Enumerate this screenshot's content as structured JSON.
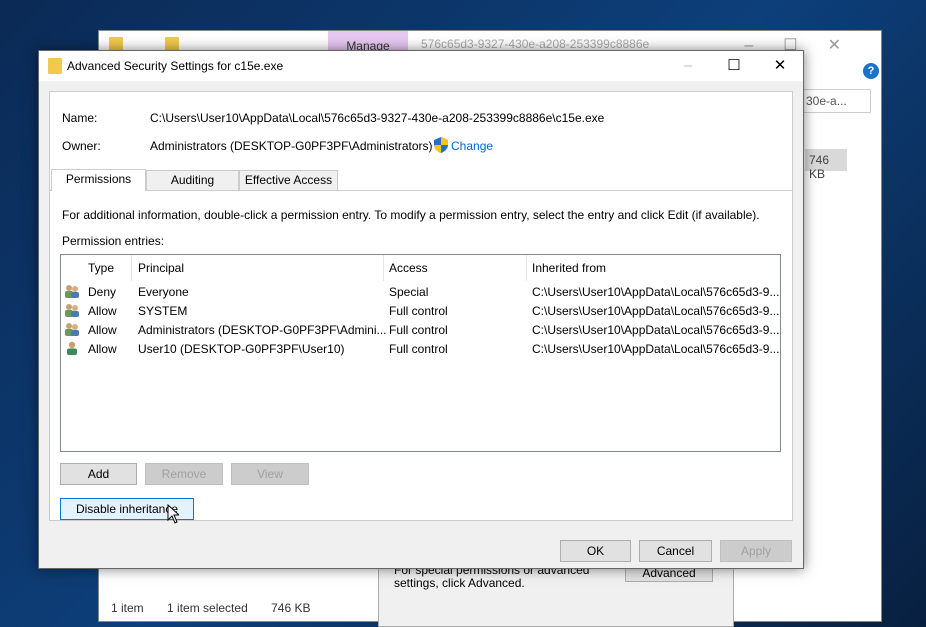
{
  "explorer": {
    "ribbon_tab": "Manage",
    "path_title": "576c65d3-9327-430e-a208-253399c8886e",
    "search_value": "30e-a...",
    "size": "746 KB",
    "status": {
      "count": "1 item",
      "selected": "1 item selected",
      "size": "746 KB"
    }
  },
  "properties": {
    "text": "For special permissions or advanced settings, click Advanced.",
    "advanced": "Advanced"
  },
  "dialog": {
    "title": "Advanced Security Settings for c15e.exe",
    "name_label": "Name:",
    "name_value": "C:\\Users\\User10\\AppData\\Local\\576c65d3-9327-430e-a208-253399c8886e\\c15e.exe",
    "owner_label": "Owner:",
    "owner_value": "Administrators (DESKTOP-G0PF3PF\\Administrators)",
    "change": "Change",
    "tabs": [
      {
        "label": "Permissions",
        "selected": true
      },
      {
        "label": "Auditing"
      },
      {
        "label": "Effective Access"
      }
    ],
    "info": "For additional information, double-click a permission entry. To modify a permission entry, select the entry and click Edit (if available).",
    "entries_label": "Permission entries:",
    "columns": [
      "Type",
      "Principal",
      "Access",
      "Inherited from"
    ],
    "rows": [
      {
        "icon": "group-icon",
        "type": "Deny",
        "principal": "Everyone",
        "access": "Special",
        "inherited": "C:\\Users\\User10\\AppData\\Local\\576c65d3-9..."
      },
      {
        "icon": "group-icon",
        "type": "Allow",
        "principal": "SYSTEM",
        "access": "Full control",
        "inherited": "C:\\Users\\User10\\AppData\\Local\\576c65d3-9..."
      },
      {
        "icon": "group-icon",
        "type": "Allow",
        "principal": "Administrators (DESKTOP-G0PF3PF\\Admini...",
        "access": "Full control",
        "inherited": "C:\\Users\\User10\\AppData\\Local\\576c65d3-9..."
      },
      {
        "icon": "user-icon",
        "type": "Allow",
        "principal": "User10 (DESKTOP-G0PF3PF\\User10)",
        "access": "Full control",
        "inherited": "C:\\Users\\User10\\AppData\\Local\\576c65d3-9..."
      }
    ],
    "add": "Add",
    "remove": "Remove",
    "view": "View",
    "disable_inheritance": "Disable inheritance",
    "ok": "OK",
    "cancel": "Cancel",
    "apply": "Apply"
  }
}
